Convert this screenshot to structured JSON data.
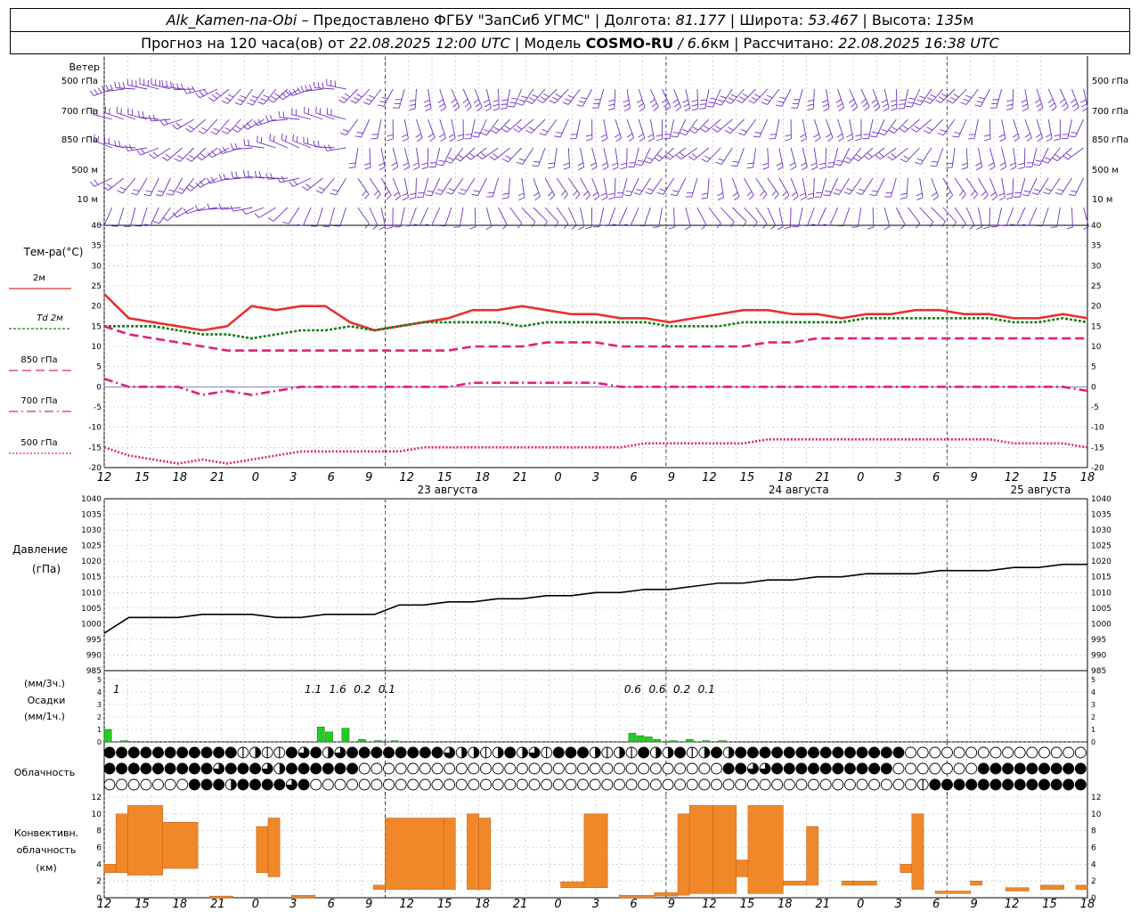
{
  "header": {
    "station": "Alk_Kamen-na-Obi",
    "provided": "– Предоставлено ФГБУ \"ЗапСиб УГМС\" | Долгота:",
    "lon": "81.177",
    "lat_label": "| Широта:",
    "lat": "53.467",
    "alt_label": "| Высота:",
    "alt": "135",
    "alt_unit": "м",
    "forecast_label": "Прогноз на 120 часа(ов) от",
    "forecast_from": "22.08.2025 12:00 UTC",
    "model_label": "| Модель",
    "model_name": "COSMO-RU",
    "model_res": "/ 6.6",
    "model_unit": "км",
    "calc_label": "| Рассчитано:",
    "calc_time": "22.08.2025 16:38 UTC"
  },
  "panels": {
    "wind": {
      "title": "Ветер",
      "levels": [
        "500 гПа",
        "700 гПа",
        "850 гПа",
        "500 м",
        "10 м"
      ]
    },
    "temp": {
      "title": "Тем-ра(°С)",
      "legend": [
        "2м",
        "Td 2м",
        "850 гПа",
        "700 гПа",
        "500 гПа"
      ]
    },
    "pressure": {
      "title1": "Давление",
      "title2": "(гПа)"
    },
    "precip": {
      "title1": "(мм/3ч.)",
      "title2": "Осадки",
      "title3": "(мм/1ч.)"
    },
    "cloud": {
      "title": "Облачность"
    },
    "conv": {
      "title1": "Конвективн.",
      "title2": "облачность",
      "title3": "(км)"
    }
  },
  "time_axis": {
    "hour_labels": [
      "12",
      "15",
      "18",
      "21",
      "0",
      "3",
      "6",
      "9",
      "12",
      "15",
      "18",
      "21",
      "0",
      "3",
      "6",
      "9",
      "12",
      "15",
      "18",
      "21",
      "0",
      "3",
      "6",
      "9",
      "12",
      "15",
      "18"
    ],
    "day_labels": [
      "23 августа",
      "24 августа",
      "25 августа"
    ]
  },
  "colors": {
    "wind": "#7030c0",
    "t2m": "#e83030",
    "td2m": "#1a7a1a",
    "t850": "#e0207a",
    "t700": "#e0207a",
    "t500": "#e0207a",
    "pressure": "#000000",
    "precip": "#22cc22",
    "conv": "#f0882a",
    "grid": "#b8b8b8"
  },
  "chart_data": [
    {
      "type": "line",
      "ylabel": "Тем-ра(°С)",
      "ylim": [
        -20,
        40
      ],
      "yticks": [
        40,
        35,
        30,
        25,
        20,
        15,
        10,
        5,
        0,
        -5,
        -10,
        -15,
        -20
      ],
      "x_hours": [
        0,
        3,
        6,
        9,
        12,
        15,
        18,
        21,
        24,
        27,
        30,
        33,
        36,
        39,
        42,
        45,
        48,
        51,
        54,
        57,
        60,
        63,
        66,
        69,
        72,
        75,
        78,
        81,
        84,
        87,
        90,
        93,
        96,
        99,
        102,
        105,
        108,
        111,
        114,
        117,
        120
      ],
      "series": [
        {
          "name": "2м",
          "values": [
            23,
            17,
            16,
            15,
            14,
            15,
            20,
            19,
            20,
            20,
            16,
            14,
            15,
            16,
            17,
            19,
            19,
            20,
            19,
            18,
            18,
            17,
            17,
            16,
            17,
            18,
            19,
            19,
            18,
            18,
            17,
            18,
            18,
            19,
            19,
            18,
            18,
            17,
            17,
            18,
            17
          ]
        },
        {
          "name": "Td 2м",
          "values": [
            15,
            15,
            15,
            14,
            13,
            13,
            12,
            13,
            14,
            14,
            15,
            14,
            15,
            16,
            16,
            16,
            16,
            15,
            16,
            16,
            16,
            16,
            16,
            15,
            15,
            15,
            16,
            16,
            16,
            16,
            16,
            17,
            17,
            17,
            17,
            17,
            17,
            16,
            16,
            17,
            16
          ]
        },
        {
          "name": "850 гПа",
          "values": [
            15,
            13,
            12,
            11,
            10,
            9,
            9,
            9,
            9,
            9,
            9,
            9,
            9,
            9,
            9,
            10,
            10,
            10,
            11,
            11,
            11,
            10,
            10,
            10,
            10,
            10,
            10,
            11,
            11,
            12,
            12,
            12,
            12,
            12,
            12,
            12,
            12,
            12,
            12,
            12,
            12
          ]
        },
        {
          "name": "700 гПа",
          "values": [
            2,
            0,
            0,
            0,
            -2,
            -1,
            -2,
            -1,
            0,
            0,
            0,
            0,
            0,
            0,
            0,
            1,
            1,
            1,
            1,
            1,
            1,
            0,
            0,
            0,
            0,
            0,
            0,
            0,
            0,
            0,
            0,
            0,
            0,
            0,
            0,
            0,
            0,
            0,
            0,
            0,
            -1
          ]
        },
        {
          "name": "500 гПа",
          "values": [
            -15,
            -17,
            -18,
            -19,
            -18,
            -19,
            -18,
            -17,
            -16,
            -16,
            -16,
            -16,
            -16,
            -15,
            -15,
            -15,
            -15,
            -15,
            -15,
            -15,
            -15,
            -15,
            -14,
            -14,
            -14,
            -14,
            -14,
            -13,
            -13,
            -13,
            -13,
            -13,
            -13,
            -13,
            -13,
            -13,
            -13,
            -14,
            -14,
            -14,
            -15
          ]
        }
      ]
    },
    {
      "type": "line",
      "ylabel": "Давление (гПа)",
      "ylim": [
        985,
        1040
      ],
      "yticks": [
        1040,
        1035,
        1030,
        1025,
        1020,
        1015,
        1010,
        1005,
        1000,
        995,
        990,
        985
      ],
      "x_hours": [
        0,
        3,
        6,
        9,
        12,
        15,
        18,
        21,
        24,
        27,
        30,
        33,
        36,
        39,
        42,
        45,
        48,
        51,
        54,
        57,
        60,
        63,
        66,
        69,
        72,
        75,
        78,
        81,
        84,
        87,
        90,
        93,
        96,
        99,
        102,
        105,
        108,
        111,
        114,
        117,
        120
      ],
      "series": [
        {
          "name": "Давление",
          "values": [
            997,
            1002,
            1002,
            1002,
            1003,
            1003,
            1003,
            1002,
            1002,
            1003,
            1003,
            1003,
            1006,
            1006,
            1007,
            1007,
            1008,
            1008,
            1009,
            1009,
            1010,
            1010,
            1011,
            1011,
            1012,
            1013,
            1013,
            1014,
            1014,
            1015,
            1015,
            1016,
            1016,
            1016,
            1017,
            1017,
            1017,
            1018,
            1018,
            1019,
            1019
          ]
        }
      ]
    },
    {
      "type": "bar",
      "ylabel": "Осадки (мм/1ч.)",
      "ylim": [
        0,
        5
      ],
      "yticks": [
        5,
        4,
        3,
        2,
        1,
        0
      ],
      "hours": [
        0,
        2,
        26,
        27,
        29,
        31,
        33,
        35,
        64,
        65,
        66,
        67,
        69,
        71,
        73,
        75
      ],
      "values": [
        1,
        0.1,
        1.2,
        0.8,
        1.1,
        0.2,
        0.1,
        0.1,
        0.7,
        0.5,
        0.4,
        0.2,
        0.1,
        0.2,
        0.1,
        0.1
      ],
      "labels_3h": [
        {
          "hour": 1.5,
          "text": "1"
        },
        {
          "hour": 25.5,
          "text": "1.1"
        },
        {
          "hour": 28.5,
          "text": "1.6"
        },
        {
          "hour": 31.5,
          "text": "0.2"
        },
        {
          "hour": 34.5,
          "text": "0.1"
        },
        {
          "hour": 64.5,
          "text": "0.6"
        },
        {
          "hour": 67.5,
          "text": "0.6"
        },
        {
          "hour": 70.5,
          "text": "0.2"
        },
        {
          "hour": 73.5,
          "text": "0.1"
        }
      ]
    },
    {
      "type": "heatmap",
      "name": "Облачность",
      "levels": 3,
      "step_hours": 1.5,
      "count": 81,
      "rows": [
        "444444444441211434234444444432212423144421214224124244444444444444000000000000000000",
        "444444444344432444444000000000000000000000000000000443344444444440000000444444444444",
        "000000044424444340000000000000000000000000000000000000000000000000014444444444444444"
      ]
    },
    {
      "type": "bar",
      "ylabel": "Конвективн. облачность (км)",
      "ylim": [
        0,
        12
      ],
      "yticks": [
        12,
        10,
        8,
        6,
        4,
        2,
        0
      ],
      "segments": [
        {
          "h0": 0,
          "h1": 1,
          "bottom": 3,
          "top": 4
        },
        {
          "h0": 1,
          "h1": 2,
          "bottom": 3,
          "top": 10
        },
        {
          "h0": 2,
          "h1": 5,
          "bottom": 2.7,
          "top": 11
        },
        {
          "h0": 5,
          "h1": 8,
          "bottom": 3.5,
          "top": 9
        },
        {
          "h0": 9,
          "h1": 11,
          "bottom": 0,
          "top": 0.2
        },
        {
          "h0": 13,
          "h1": 14,
          "bottom": 3,
          "top": 8.5
        },
        {
          "h0": 14,
          "h1": 15,
          "bottom": 2.5,
          "top": 9.5
        },
        {
          "h0": 16,
          "h1": 18,
          "bottom": 0,
          "top": 0.3
        },
        {
          "h0": 23,
          "h1": 24,
          "bottom": 1,
          "top": 1.5
        },
        {
          "h0": 24,
          "h1": 29,
          "bottom": 1,
          "top": 9.5
        },
        {
          "h0": 29,
          "h1": 30,
          "bottom": 1,
          "top": 9.5
        },
        {
          "h0": 31,
          "h1": 32,
          "bottom": 1,
          "top": 10
        },
        {
          "h0": 32,
          "h1": 33,
          "bottom": 1,
          "top": 9.5
        },
        {
          "h0": 39,
          "h1": 41,
          "bottom": 1.2,
          "top": 1.9
        },
        {
          "h0": 41,
          "h1": 43,
          "bottom": 1.2,
          "top": 10
        },
        {
          "h0": 44,
          "h1": 47,
          "bottom": 0,
          "top": 0.3
        },
        {
          "h0": 47,
          "h1": 49,
          "bottom": 0.2,
          "top": 0.6
        },
        {
          "h0": 49,
          "h1": 50,
          "bottom": 0.3,
          "top": 10
        },
        {
          "h0": 50,
          "h1": 52,
          "bottom": 0.5,
          "top": 11
        },
        {
          "h0": 52,
          "h1": 54,
          "bottom": 0.5,
          "top": 11
        },
        {
          "h0": 54,
          "h1": 55,
          "bottom": 2.5,
          "top": 4.5
        },
        {
          "h0": 55,
          "h1": 58,
          "bottom": 0.5,
          "top": 11
        },
        {
          "h0": 58,
          "h1": 60,
          "bottom": 1.5,
          "top": 2
        },
        {
          "h0": 60,
          "h1": 61,
          "bottom": 1.5,
          "top": 8.5
        },
        {
          "h0": 63,
          "h1": 64,
          "bottom": 1.5,
          "top": 2
        },
        {
          "h0": 64,
          "h1": 66,
          "bottom": 1.5,
          "top": 2
        },
        {
          "h0": 68,
          "h1": 69,
          "bottom": 3,
          "top": 4
        },
        {
          "h0": 69,
          "h1": 70,
          "bottom": 1,
          "top": 10
        },
        {
          "h0": 71,
          "h1": 74,
          "bottom": 0.5,
          "top": 0.8
        },
        {
          "h0": 74,
          "h1": 75,
          "bottom": 1.5,
          "top": 2
        },
        {
          "h0": 77,
          "h1": 79,
          "bottom": 0.8,
          "top": 1.2
        },
        {
          "h0": 80,
          "h1": 82,
          "bottom": 1,
          "top": 1.5
        },
        {
          "h0": 83,
          "h1": 84,
          "bottom": 1,
          "top": 1.5
        }
      ]
    },
    {
      "type": "scatter",
      "name": "Ветер (barbs)",
      "levels": [
        "500 гПа",
        "700 гПа",
        "850 гПа",
        "500 м",
        "10 м"
      ],
      "x_hours_step": 1.5,
      "direction_deg_by_level": [
        250,
        255,
        260,
        240,
        230
      ],
      "speed_ms_by_level": [
        15,
        12,
        10,
        8,
        5
      ]
    }
  ]
}
